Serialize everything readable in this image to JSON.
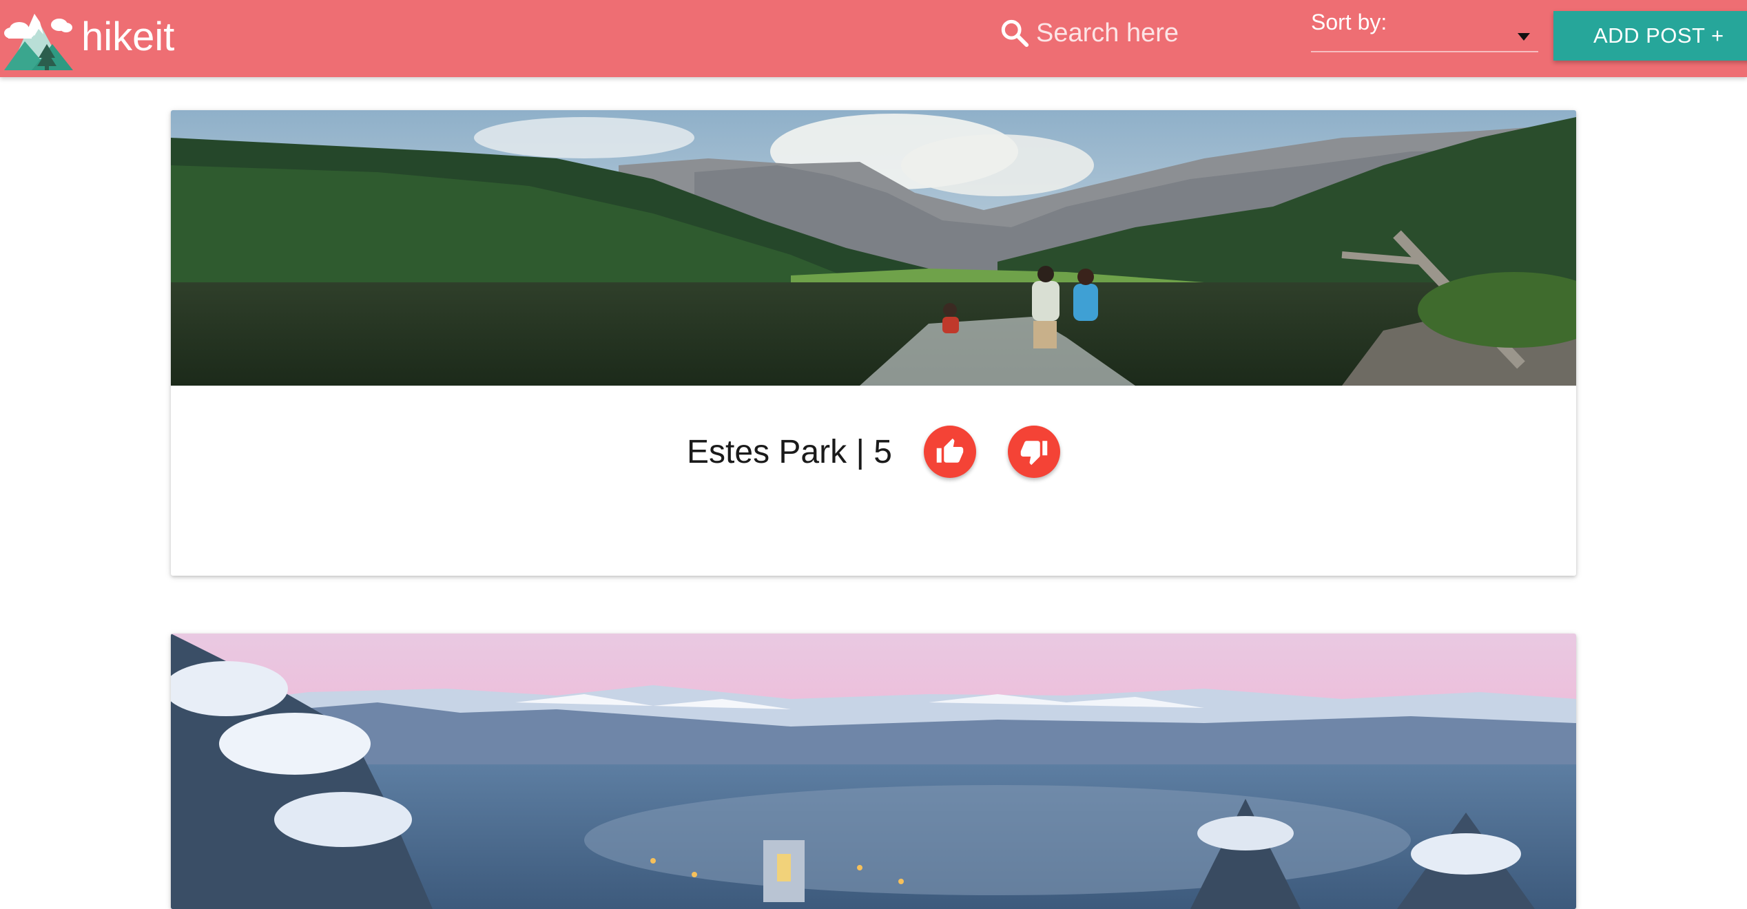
{
  "navbar": {
    "brand": "hikeit",
    "search": {
      "placeholder": "Search here",
      "value": ""
    },
    "sort": {
      "label": "Sort by:",
      "selected": ""
    },
    "add_post_label": "ADD POST +",
    "colors": {
      "background": "#ee6e73",
      "add_post": "#26a69a"
    }
  },
  "posts": [
    {
      "title": "Estes Park | 5",
      "image": "mountain-lake-hikers",
      "actions": {
        "upvote_icon": "thumb-up-icon",
        "downvote_icon": "thumb-down-icon"
      }
    },
    {
      "title": "",
      "image": "snowy-mountain-town-at-dusk"
    }
  ],
  "colors": {
    "vote_button": "#f44336"
  }
}
